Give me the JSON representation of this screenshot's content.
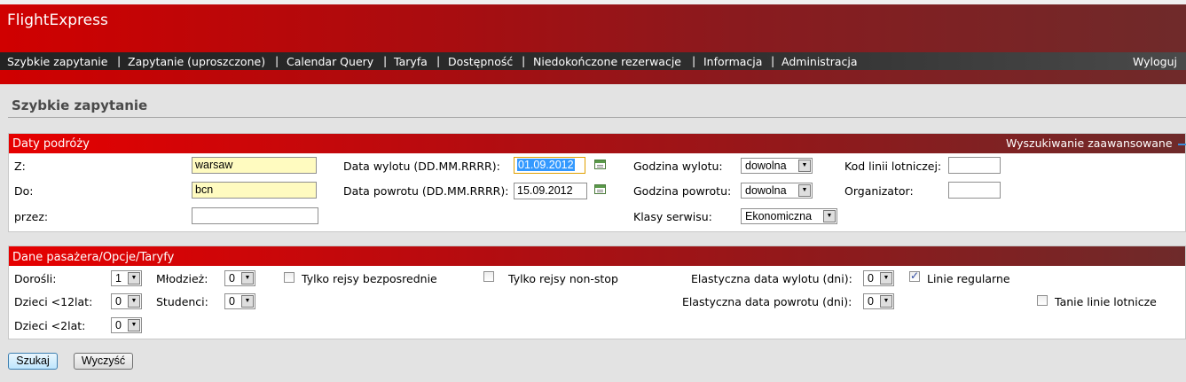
{
  "app": {
    "title": "FlightExpress"
  },
  "nav": {
    "items": [
      "Szybkie zapytanie",
      "Zapytanie (uproszczone)",
      "Calendar Query",
      "Taryfa",
      "Dostępność",
      "Niedokończone rezerwacje",
      "Informacja",
      "Administracja"
    ],
    "separator": "|",
    "logout": "Wyloguj"
  },
  "page": {
    "title": "Szybkie zapytanie"
  },
  "travel": {
    "title": "Daty podróży",
    "advanced_link": "Wyszukiwanie zaawansowane",
    "from_label": "Z:",
    "from_value": "warsaw",
    "to_label": "Do:",
    "to_value": "bcn",
    "via_label": "przez:",
    "via_value": "",
    "depart_date_label": "Data wylotu (DD.MM.RRRR):",
    "depart_date_value": "01.09.2012",
    "return_date_label": "Data powrotu (DD.MM.RRRR):",
    "return_date_value": "15.09.2012",
    "depart_time_label": "Godzina wylotu:",
    "depart_time_value": "dowolna",
    "return_time_label": "Godzina powrotu:",
    "return_time_value": "dowolna",
    "class_label": "Klasy serwisu:",
    "class_value": "Ekonomiczna",
    "airline_label": "Kod linii lotniczej:",
    "airline_value": "",
    "organizer_label": "Organizator:",
    "organizer_value": ""
  },
  "passenger": {
    "title": "Dane pasażera/Opcje/Taryfy",
    "adults_label": "Dorośli:",
    "adults_value": "1",
    "youth_label": "Młodzież:",
    "youth_value": "0",
    "children_label": "Dzieci <12lat:",
    "children_value": "0",
    "students_label": "Studenci:",
    "students_value": "0",
    "infants_label": "Dzieci <2lat:",
    "infants_value": "0",
    "direct_only_label": "Tylko rejsy bezposrednie",
    "direct_only_checked": false,
    "nonstop_only_label": "Tylko rejsy non-stop",
    "nonstop_only_checked": false,
    "flex_depart_label": "Elastyczna data wylotu (dni):",
    "flex_depart_value": "0",
    "flex_return_label": "Elastyczna data powrotu (dni):",
    "flex_return_value": "0",
    "regular_lines_label": "Linie regularne",
    "regular_lines_checked": true,
    "lowcost_label": "Tanie linie lotnicze",
    "lowcost_checked": false
  },
  "actions": {
    "search": "Szukaj",
    "clear": "Wyczyść"
  },
  "colors": {
    "header_red": "#d00000",
    "header_dark": "#6f2a2a",
    "nav_bg": "#232323",
    "highlight": "#3399ff"
  }
}
